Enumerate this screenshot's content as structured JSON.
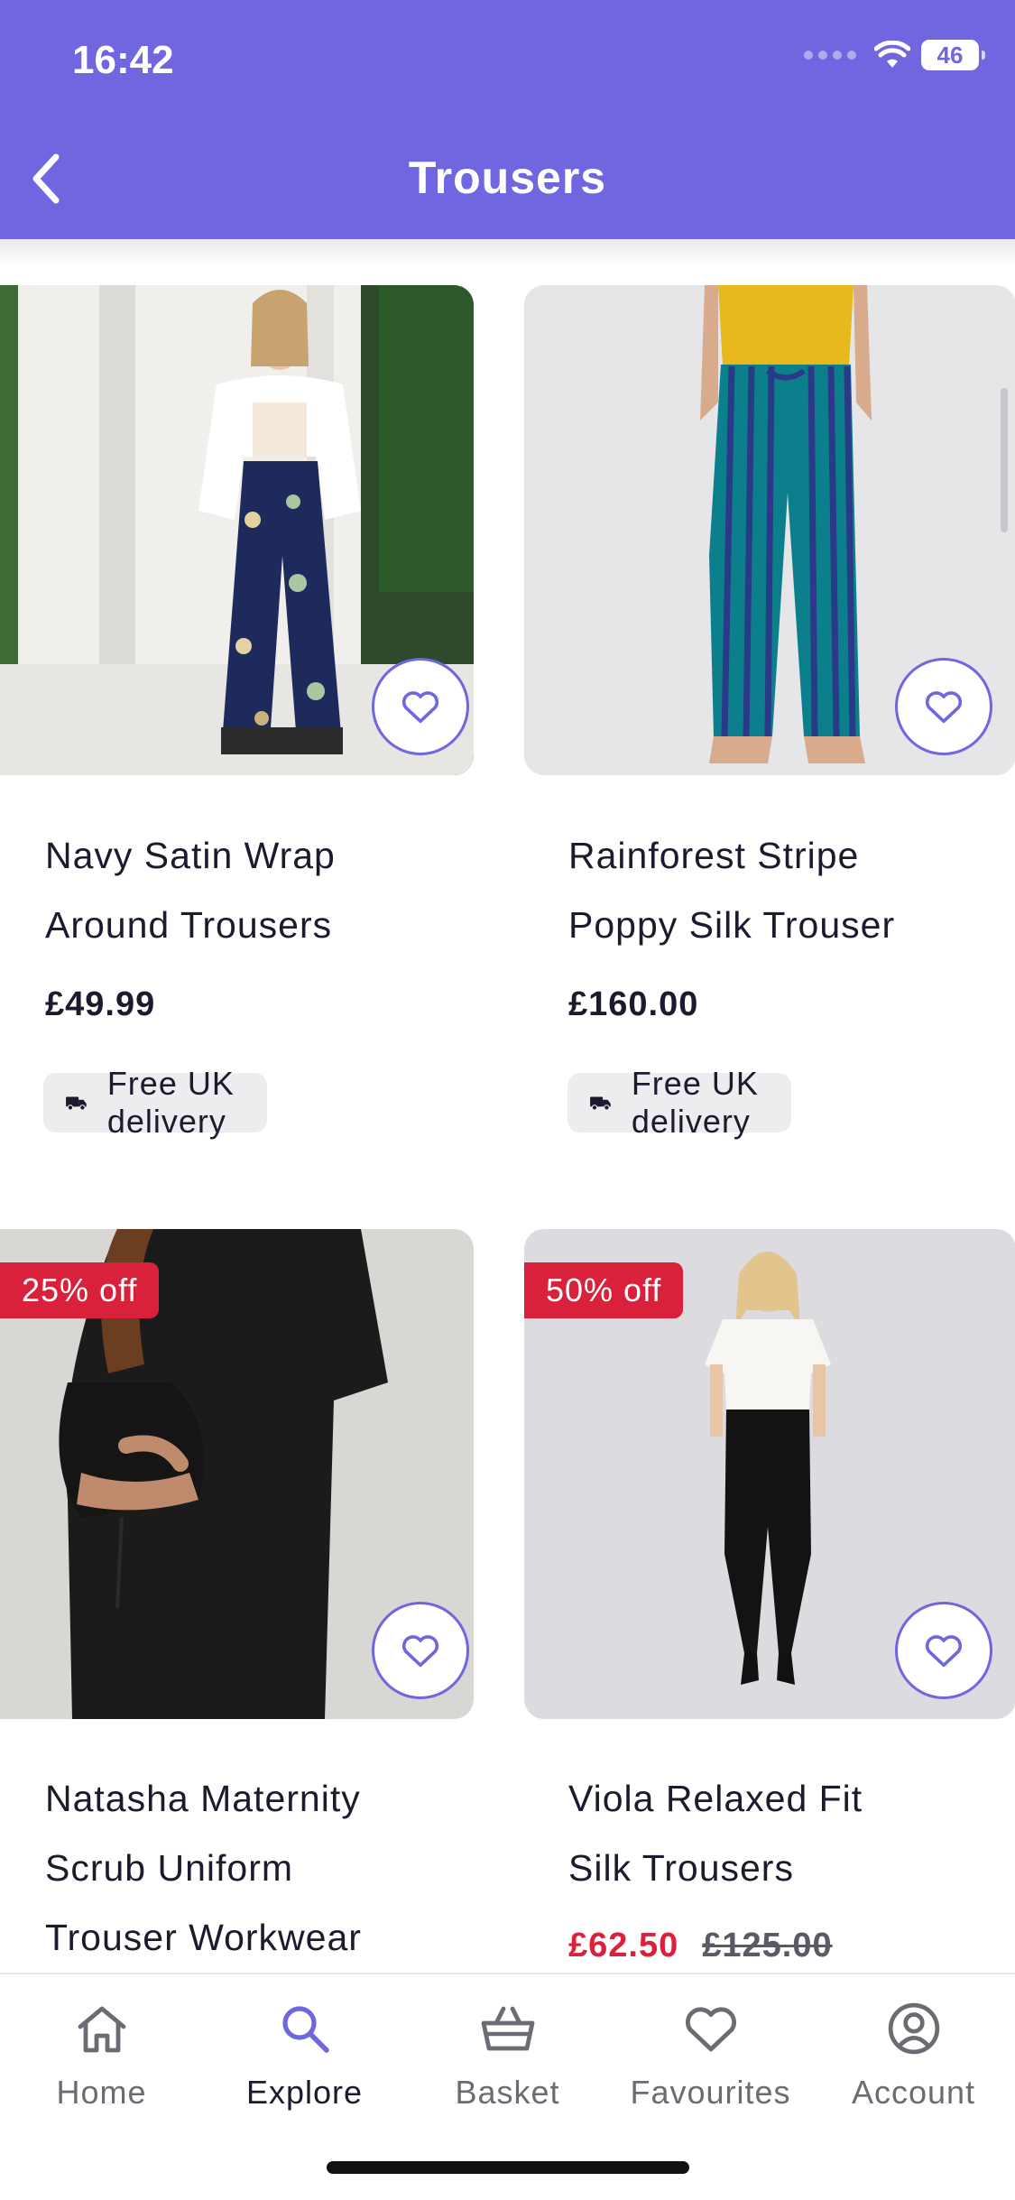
{
  "status": {
    "time": "16:42",
    "battery": "46"
  },
  "header": {
    "title": "Trousers"
  },
  "products": [
    {
      "name_line1": "Navy Satin Wrap",
      "name_line2": "Around Trousers",
      "price": "£49.99",
      "delivery": "Free UK delivery"
    },
    {
      "name_line1": "Rainforest Stripe",
      "name_line2": "Poppy Silk Trouser",
      "price": "£160.00",
      "delivery": "Free UK delivery"
    },
    {
      "badge": "25% off",
      "name_line1": "Natasha Maternity",
      "name_line2": "Scrub Uniform",
      "name_line3": "Trouser Workwear"
    },
    {
      "badge": "50% off",
      "name_line1": "Viola Relaxed Fit",
      "name_line2": "Silk Trousers",
      "sale_price": "£62.50",
      "was_price": "£125.00"
    }
  ],
  "tabbar": [
    {
      "label": "Home",
      "icon": "home-icon"
    },
    {
      "label": "Explore",
      "icon": "search-icon",
      "active": true
    },
    {
      "label": "Basket",
      "icon": "basket-icon"
    },
    {
      "label": "Favourites",
      "icon": "heart-icon"
    },
    {
      "label": "Account",
      "icon": "account-icon"
    }
  ],
  "colors": {
    "brand": "#6f66e0",
    "sale": "#d9213b"
  }
}
